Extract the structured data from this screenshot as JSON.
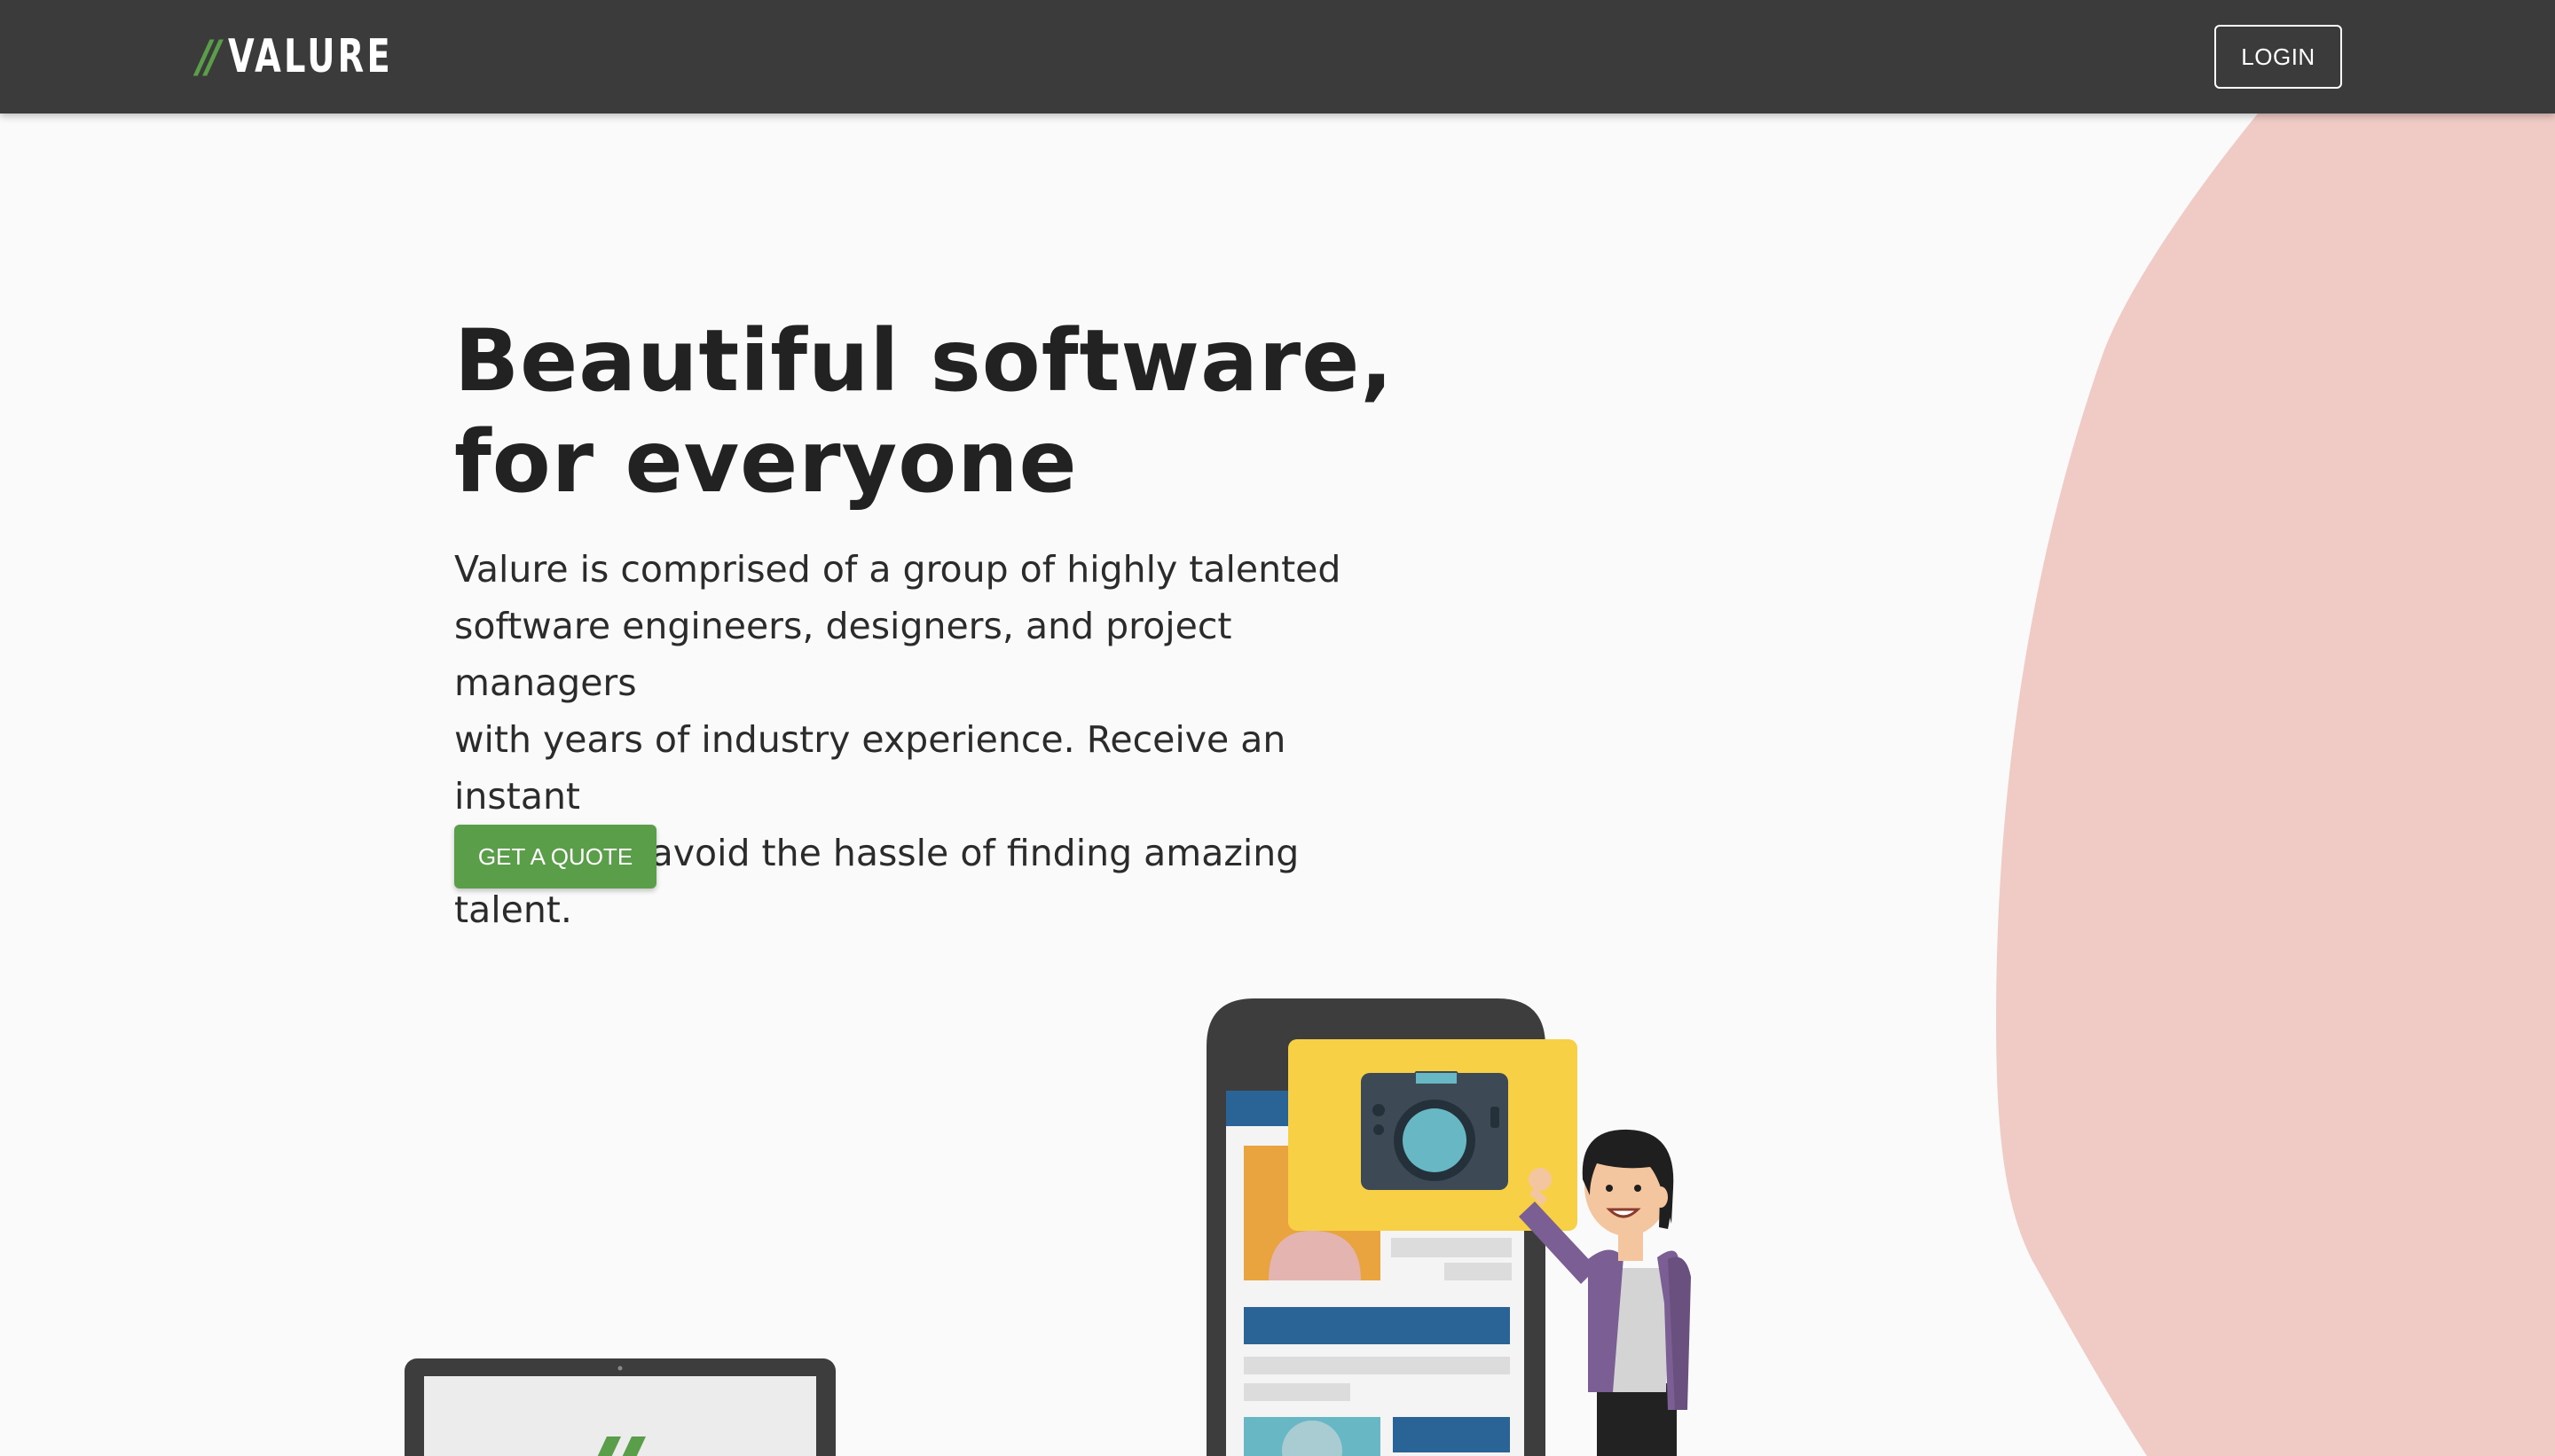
{
  "header": {
    "logo_mark": "//",
    "logo_text": "VALURE",
    "login_label": "LOGIN"
  },
  "hero": {
    "title_line1": "Beautiful software,",
    "title_line2": "for everyone",
    "body_line1": "Valure is comprised of a group of highly talented",
    "body_line2": "software engineers, designers, and project managers",
    "body_line3": "with years of industry experience. Receive an instant",
    "body_line4": "quote and avoid the hassle of finding amazing talent.",
    "cta_label": "GET A QUOTE"
  },
  "colors": {
    "header_bg": "#3b3b3b",
    "accent_green": "#5b9e4a",
    "blob_pink": "#f0cbc6",
    "page_bg": "#fafafa",
    "card_yellow": "#f8d045",
    "blue": "#2a6496"
  },
  "icons": [
    "camera-icon",
    "quote-mark-icon"
  ]
}
